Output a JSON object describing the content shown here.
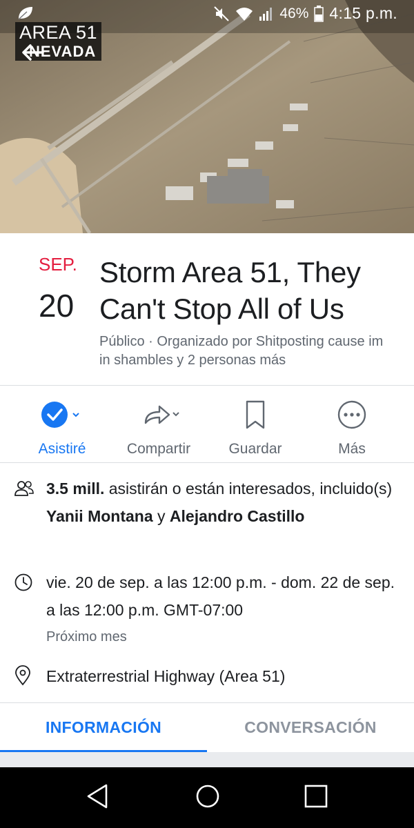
{
  "status_bar": {
    "battery": "46%",
    "time": "4:15 p.m.",
    "icons": [
      "leaf-icon",
      "mute-icon",
      "wifi-icon",
      "signal-icon",
      "battery-icon"
    ]
  },
  "cover": {
    "badge_line1": "AREA 51",
    "badge_line2": "NEVADA"
  },
  "event": {
    "month": "SEP.",
    "day": "20",
    "title": "Storm Area 51, They Can't Stop All of Us",
    "meta": "Público · Organizado por Shitposting cause im in shambles y 2 personas más"
  },
  "actions": [
    {
      "label": "Asistiré",
      "icon": "check-circle-icon",
      "active": true
    },
    {
      "label": "Compartir",
      "icon": "share-icon",
      "active": false
    },
    {
      "label": "Guardar",
      "icon": "bookmark-icon",
      "active": false
    },
    {
      "label": "Más",
      "icon": "more-icon",
      "active": false
    }
  ],
  "details": {
    "attendance_count": "3.5 mill.",
    "attendance_text": " asistirán o están interesados, incluido(s) ",
    "attendance_name1": "Yanii Montana",
    "attendance_and": " y ",
    "attendance_name2": "Alejandro Castillo",
    "datetime": "vie. 20 de sep. a las 12:00 p.m. - dom. 22 de sep. a las 12:00 p.m. GMT-07:00",
    "datetime_sub": "Próximo mes",
    "location": "Extraterrestrial Highway (Area 51)"
  },
  "tabs": [
    {
      "label": "INFORMACIÓN",
      "active": true
    },
    {
      "label": "CONVERSACIÓN",
      "active": false
    }
  ],
  "colors": {
    "accent": "#1877f2",
    "date_red": "#e41e3f",
    "secondary_text": "#606770"
  }
}
